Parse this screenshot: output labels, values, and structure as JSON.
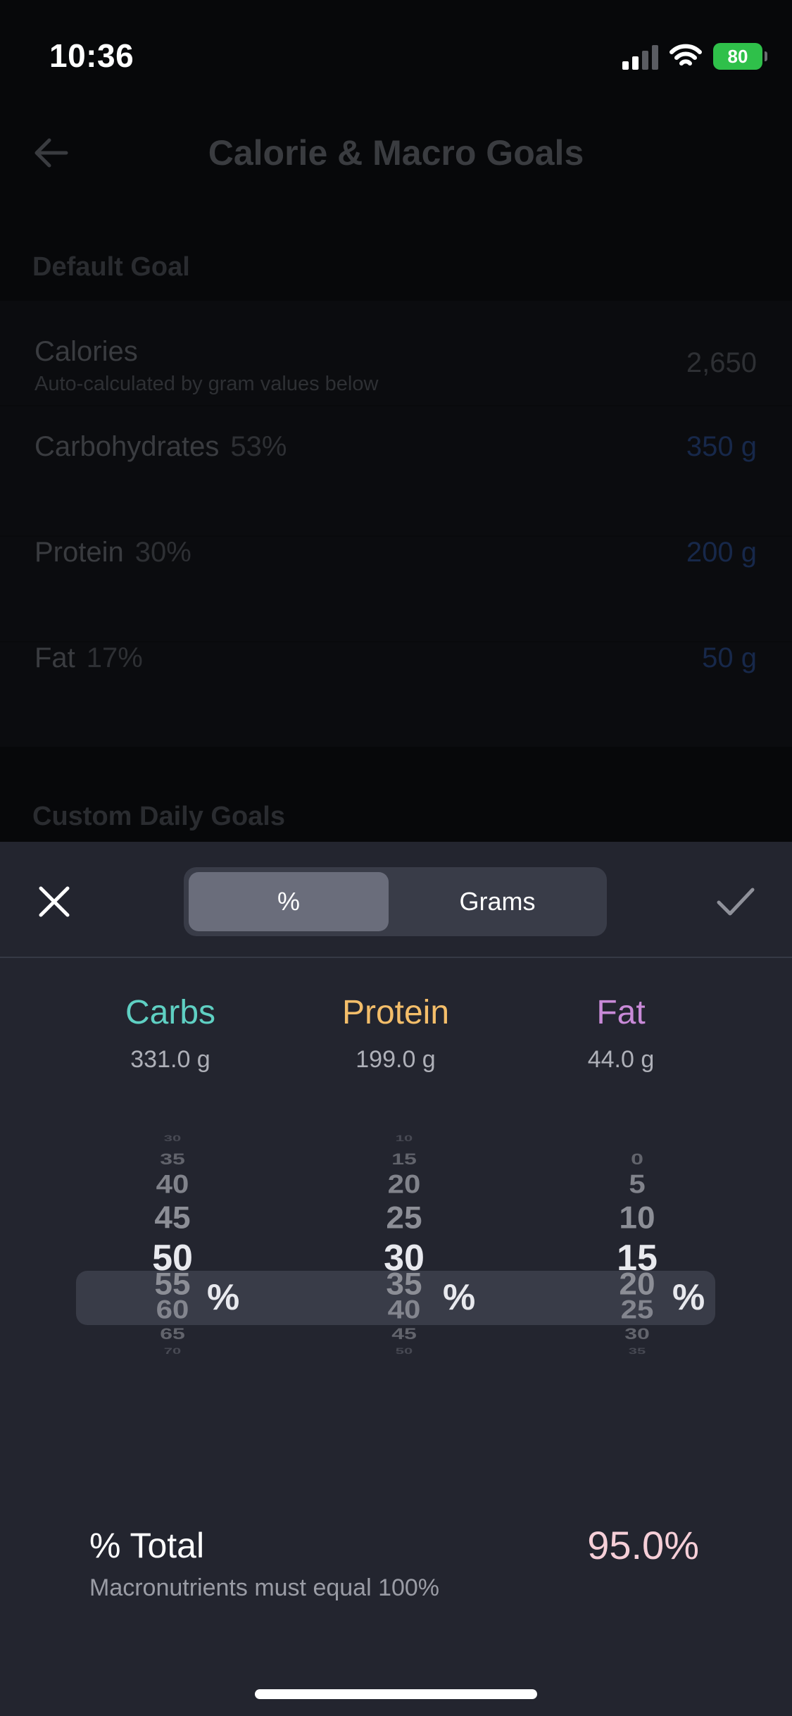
{
  "status_bar": {
    "time": "10:36",
    "battery": "80"
  },
  "header": {
    "title": "Calorie & Macro Goals"
  },
  "default_goal": {
    "section_label": "Default Goal",
    "calories": {
      "name": "Calories",
      "subtitle": "Auto-calculated by gram values below",
      "value": "2,650"
    },
    "carbohydrates": {
      "name": "Carbohydrates",
      "percent": "53%",
      "value": "350 g"
    },
    "protein": {
      "name": "Protein",
      "percent": "30%",
      "value": "200 g"
    },
    "fat": {
      "name": "Fat",
      "percent": "17%",
      "value": "50 g"
    }
  },
  "custom_section_label": "Custom Daily Goals",
  "sheet": {
    "mode_options": {
      "percent": "%",
      "grams": "Grams"
    },
    "selected_mode": "%",
    "macros": [
      {
        "name": "Carbs",
        "grams": "331.0 g",
        "color": "#5fd0c3",
        "picker": [
          "30",
          "35",
          "40",
          "45",
          "50",
          "55",
          "60",
          "65",
          "70"
        ],
        "selected": "50"
      },
      {
        "name": "Protein",
        "grams": "199.0 g",
        "color": "#f4be6a",
        "picker": [
          "10",
          "15",
          "20",
          "25",
          "30",
          "35",
          "40",
          "45",
          "50"
        ],
        "selected": "30"
      },
      {
        "name": "Fat",
        "grams": "44.0 g",
        "color": "#c98ad8",
        "picker": [
          "",
          "0",
          "5",
          "10",
          "15",
          "20",
          "25",
          "30",
          "35"
        ],
        "selected": "15"
      }
    ],
    "percent_suffix": "%",
    "total": {
      "label": "% Total",
      "subtitle": "Macronutrients must equal 100%",
      "value": "95.0%"
    }
  },
  "colors": {
    "value_blue": "#17284a",
    "sheet_bg": "#23252f",
    "accent_total": "#f6cfd8"
  }
}
